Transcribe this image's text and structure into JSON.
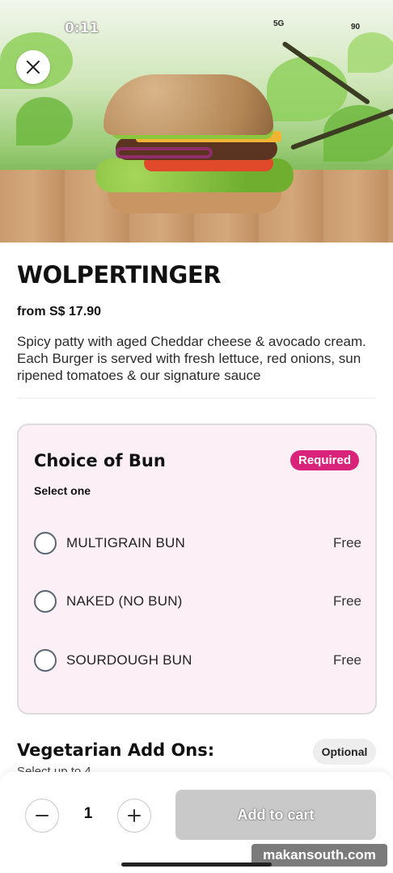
{
  "status_bar": {
    "time": "0:11",
    "network": "5G",
    "battery": "90"
  },
  "product": {
    "name": "WOLPERTINGER",
    "price": "from S$ 17.90",
    "description": "Spicy patty with aged Cheddar cheese & avocado cream. Each Burger is served with fresh lettuce, red onions, sun ripened tomatoes & our signature sauce"
  },
  "bun_section": {
    "title": "Choice of Bun",
    "badge": "Required",
    "subtitle": "Select one",
    "options": [
      {
        "label": "MULTIGRAIN BUN",
        "price": "Free",
        "selected": false
      },
      {
        "label": "NAKED (NO BUN)",
        "price": "Free",
        "selected": false
      },
      {
        "label": "SOURDOUGH BUN",
        "price": "Free",
        "selected": false
      }
    ]
  },
  "addons_section": {
    "title": "Vegetarian Add Ons:",
    "subtitle": "Select up to 4",
    "badge": "Optional"
  },
  "cart": {
    "quantity": "1",
    "add_label": "Add to cart"
  },
  "watermark": "makansouth.com",
  "colors": {
    "accent": "#d9237a",
    "card_bg": "#fcf0f6",
    "disabled_button": "#c9c9c9"
  },
  "icons": {
    "close": "close-icon",
    "minus": "minus-icon",
    "plus": "plus-icon"
  }
}
